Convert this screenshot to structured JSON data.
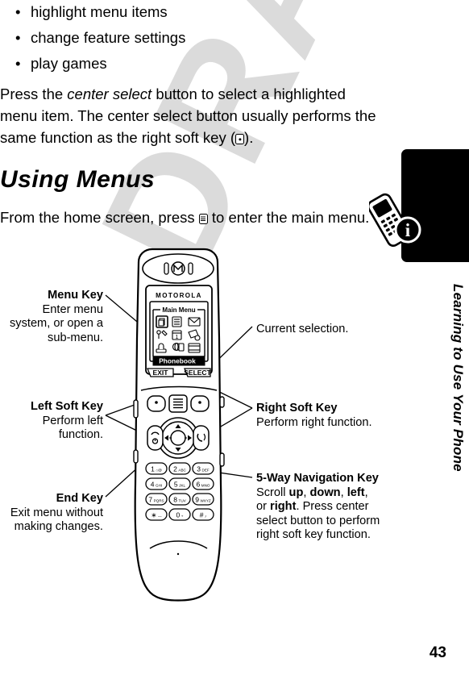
{
  "page": {
    "number": "43",
    "side_title": "Learning to Use Your Phone",
    "watermark": "DRAFT"
  },
  "bullets": [
    {
      "marker": "•",
      "text": "highlight menu items"
    },
    {
      "marker": "•",
      "text": "change feature settings"
    },
    {
      "marker": "•",
      "text": "play games"
    }
  ],
  "intro_paragraph": {
    "part1": "Press the ",
    "italic": "center select",
    "part2": " button to select a highlighted menu item. The center select button usually performs the same function as the right soft key (",
    "part3": ")."
  },
  "section": {
    "title": "Using Menus",
    "paragraph_part1": "From the home screen, press ",
    "paragraph_part2": " to enter the main menu."
  },
  "diagram": {
    "phone": {
      "brand": "MOTOROLA",
      "screen": {
        "menu_title": "Main Menu",
        "highlighted_item": "Phonebook",
        "icons": [
          "phonebook-icon",
          "recent-calls-icon",
          "messages-icon",
          "settings-tools-icon",
          "calendar-icon",
          "office-tools-icon",
          "games-icon",
          "web-access-icon",
          "multimedia-icon"
        ],
        "left_soft_label": "EXIT",
        "right_soft_label": "SELECT"
      },
      "keypad": [
        {
          "digit": "1",
          "letters": "⌂@"
        },
        {
          "digit": "2",
          "letters": "ABC"
        },
        {
          "digit": "3",
          "letters": "DEF"
        },
        {
          "digit": "4",
          "letters": "GHI"
        },
        {
          "digit": "5",
          "letters": "JKL"
        },
        {
          "digit": "6",
          "letters": "MNO"
        },
        {
          "digit": "7",
          "letters": "PQRS"
        },
        {
          "digit": "8",
          "letters": "TUV"
        },
        {
          "digit": "9",
          "letters": "WXYZ"
        },
        {
          "digit": "∗",
          "letters": "—"
        },
        {
          "digit": "0",
          "letters": "+"
        },
        {
          "digit": "#",
          "letters": "♪"
        }
      ]
    },
    "callouts": {
      "menu_key": {
        "heading": "Menu Key",
        "body": "Enter menu system, or open a sub-menu."
      },
      "left_soft_key": {
        "heading": "Left Soft Key",
        "body": "Perform left function."
      },
      "end_key": {
        "heading": "End Key",
        "body": "Exit menu without making changes."
      },
      "current_selection": {
        "heading": "",
        "body": "Current selection."
      },
      "right_soft_key": {
        "heading": "Right Soft Key",
        "body": "Perform right function."
      },
      "nav_key": {
        "heading": "5-Way Navigation Key",
        "body_part1": "Scroll ",
        "b1": "up",
        "sep1": ", ",
        "b2": "down",
        "sep2": ", ",
        "b3": "left",
        "sep3": ", or ",
        "b4": "right",
        "body_part2": ". Press center select button to perform right soft key function."
      }
    }
  },
  "colors": {
    "ink": "#000000",
    "watermark": "#cfcfcf",
    "paper": "#ffffff"
  }
}
